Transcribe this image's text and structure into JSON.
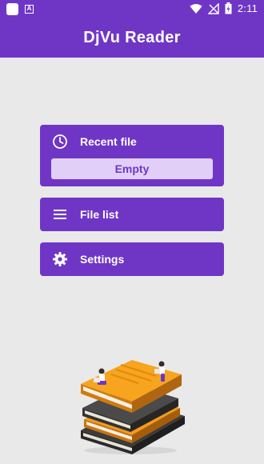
{
  "status": {
    "time": "2:11"
  },
  "app": {
    "title": "DjVu Reader"
  },
  "menu": {
    "recent": {
      "label": "Recent file",
      "value": "Empty"
    },
    "file_list": {
      "label": "File list"
    },
    "settings": {
      "label": "Settings"
    }
  },
  "colors": {
    "primary": "#6f36c6",
    "accent_light": "#e2cff8",
    "background": "#e9e9e9"
  },
  "icons": {
    "recent": "clock-icon",
    "file_list": "list-icon",
    "settings": "gear-icon"
  }
}
